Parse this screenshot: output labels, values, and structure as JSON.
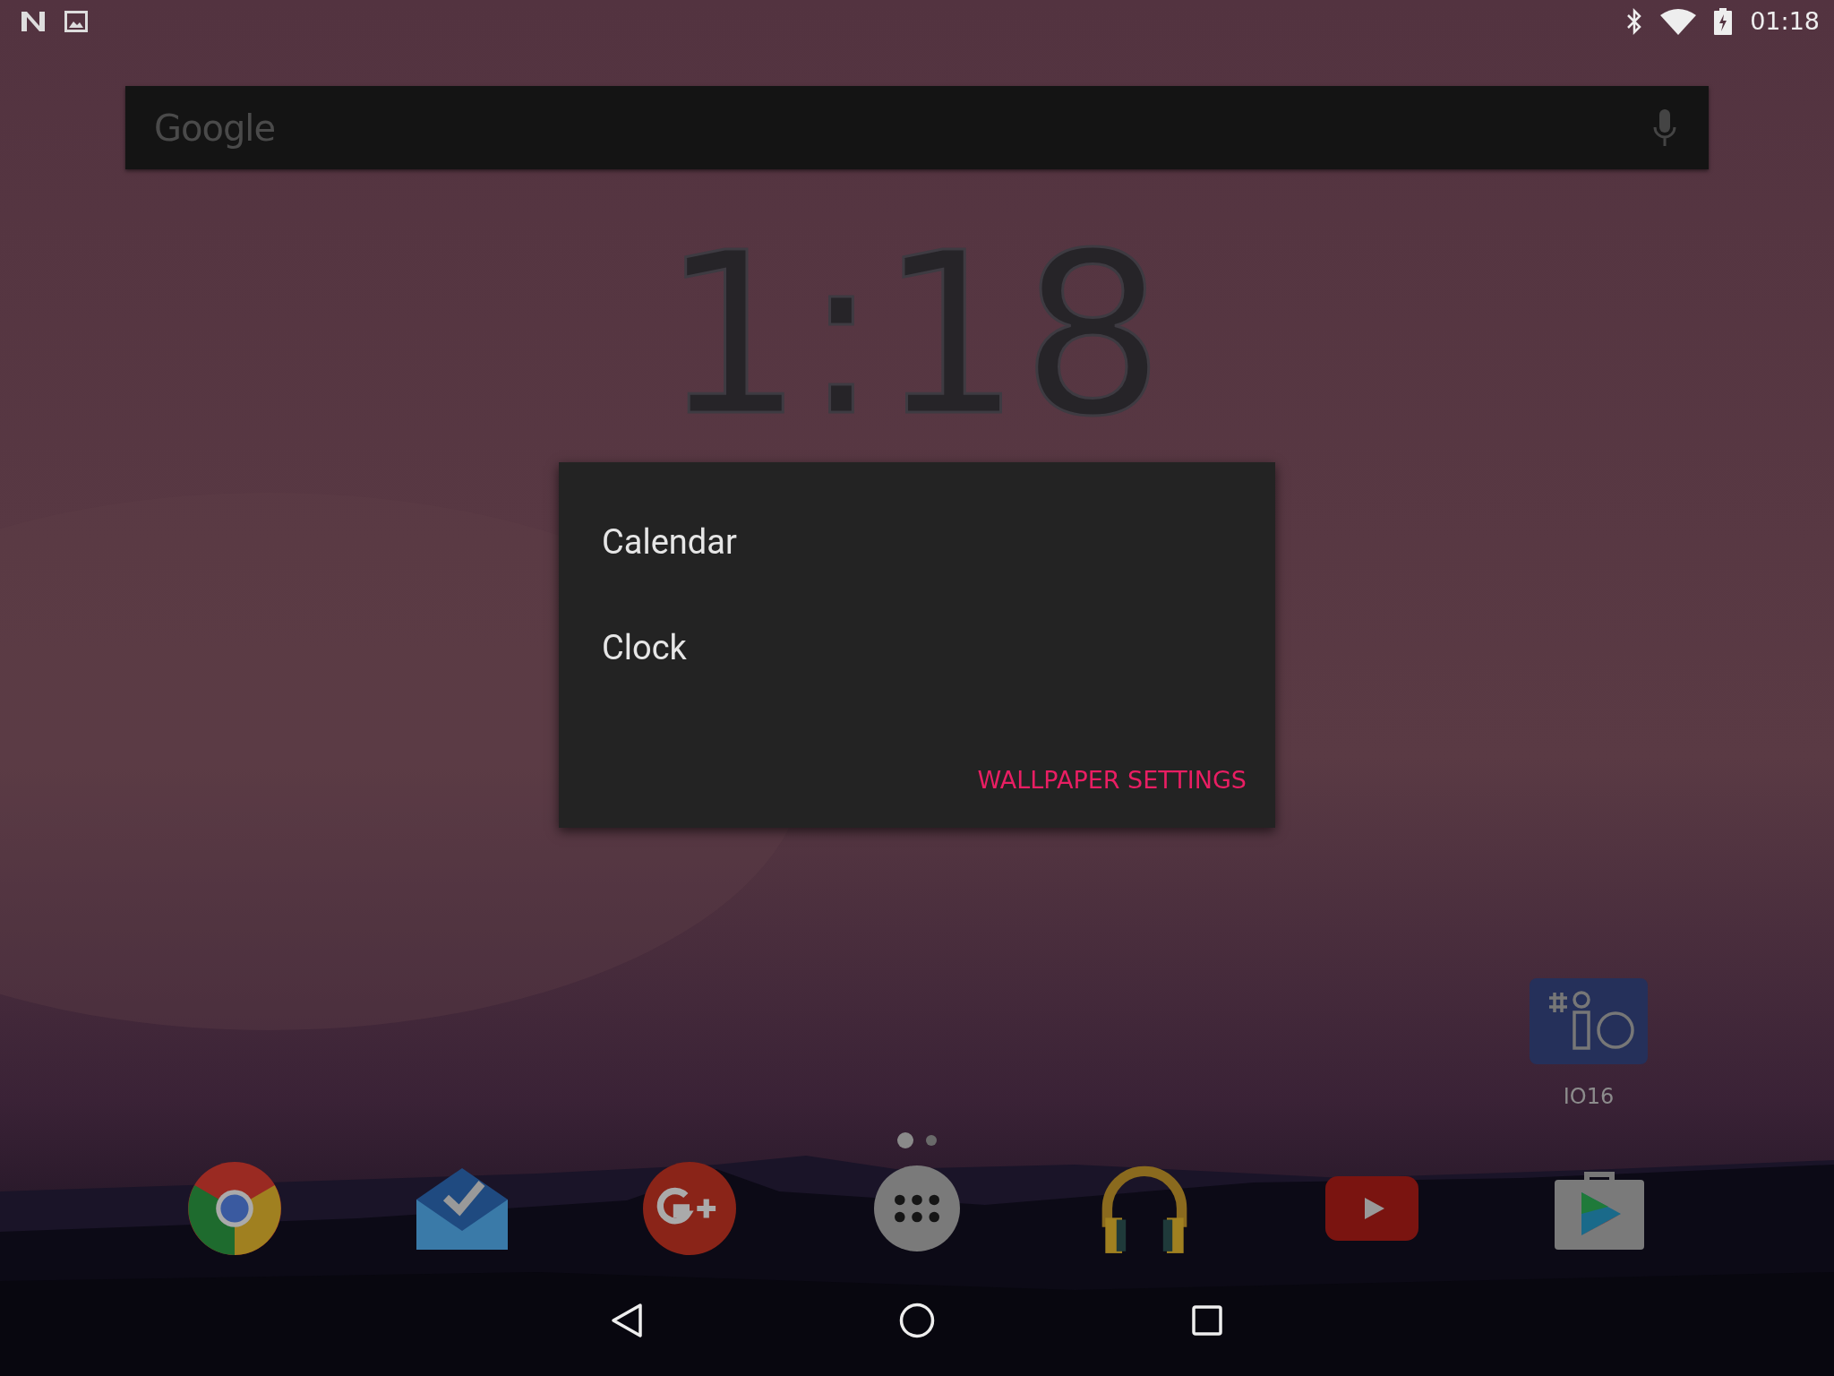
{
  "status_bar": {
    "time": "01:18"
  },
  "search": {
    "hint": "Google"
  },
  "clock": {
    "time": "1:18"
  },
  "dialog": {
    "items": [
      {
        "label": "Calendar"
      },
      {
        "label": "Clock"
      }
    ],
    "action": "WALLPAPER SETTINGS"
  },
  "shortcut": {
    "label": "IO16"
  },
  "pages": [
    {
      "selected": true
    },
    {
      "selected": false
    }
  ],
  "dock": [
    {
      "kind": "chrome"
    },
    {
      "kind": "inbox"
    },
    {
      "kind": "gplus"
    },
    {
      "kind": "drawer"
    },
    {
      "kind": "music"
    },
    {
      "kind": "youtube"
    },
    {
      "kind": "store"
    }
  ],
  "nav": [
    {
      "kind": "back"
    },
    {
      "kind": "home"
    },
    {
      "kind": "recents"
    }
  ]
}
